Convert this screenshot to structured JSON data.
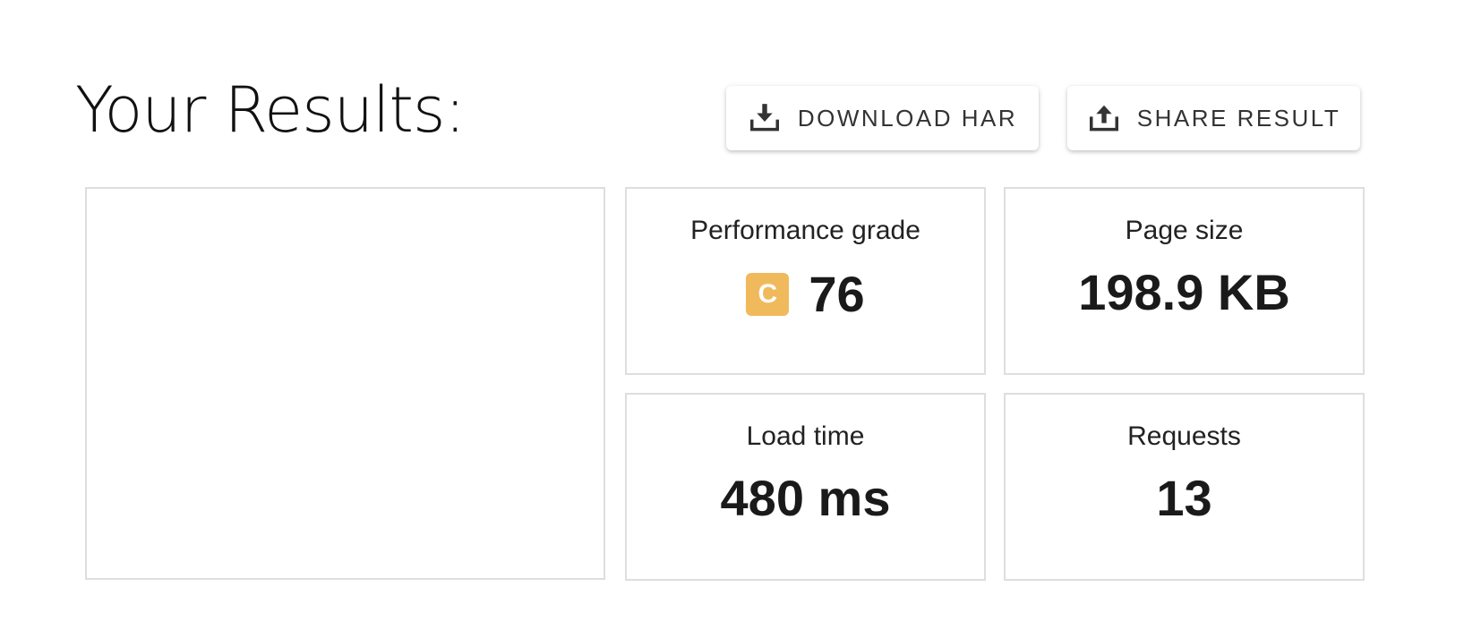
{
  "header": {
    "title": "Your Results:",
    "download_label": "DOWNLOAD HAR",
    "share_label": "SHARE RESULT",
    "download_icon": "download-icon",
    "share_icon": "share-upload-icon"
  },
  "metrics": {
    "performance": {
      "label": "Performance grade",
      "grade": "C",
      "score": "76",
      "grade_color": "#f0b95b"
    },
    "page_size": {
      "label": "Page size",
      "value": "198.9 KB"
    },
    "load_time": {
      "label": "Load time",
      "value": "480 ms"
    },
    "requests": {
      "label": "Requests",
      "value": "13"
    }
  }
}
